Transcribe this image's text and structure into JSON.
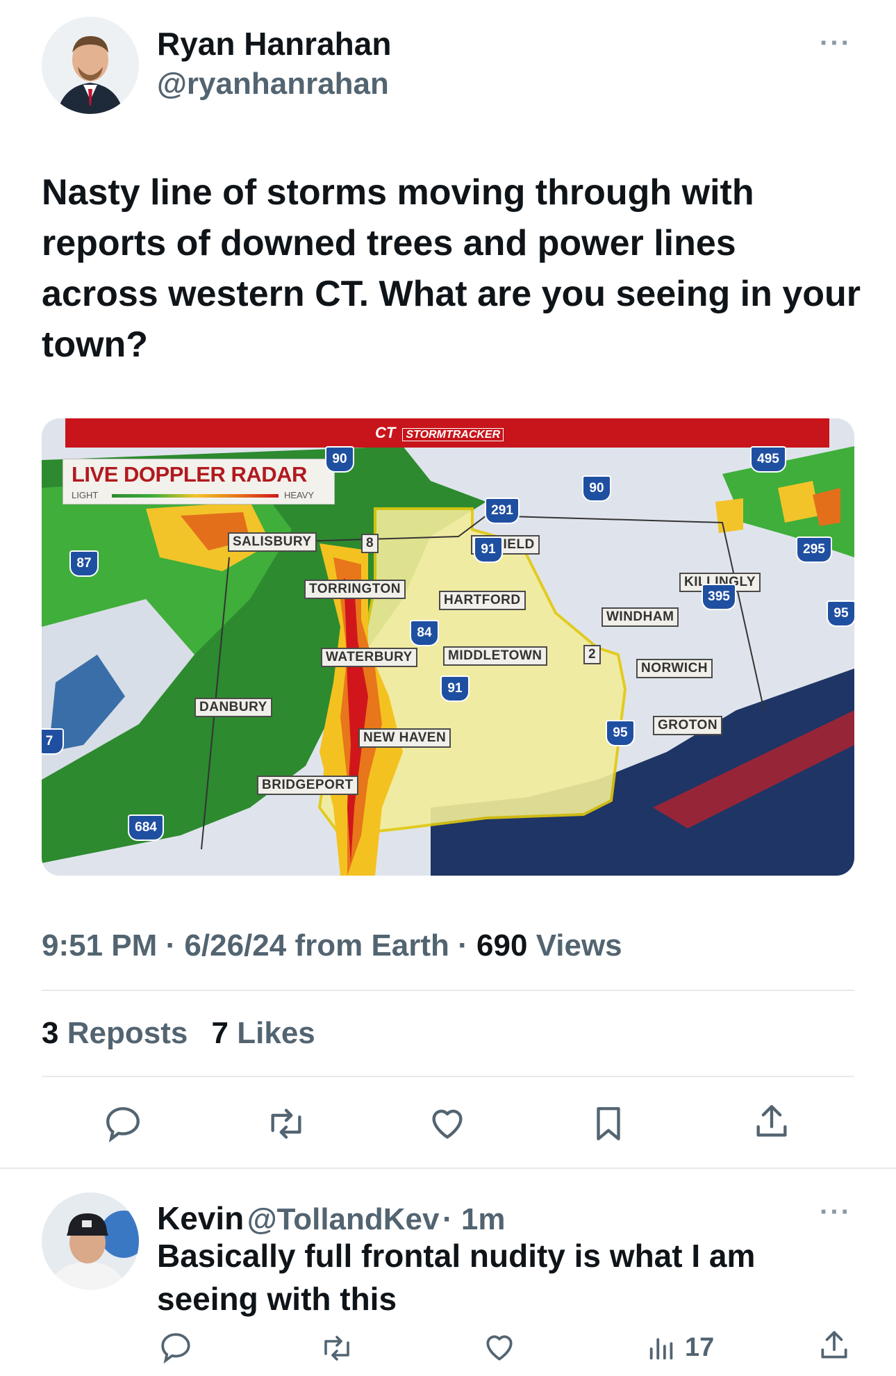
{
  "tweet": {
    "author_name": "Ryan Hanrahan",
    "author_handle": "@ryanhanrahan",
    "more": "···",
    "text": "Nasty line of storms moving through with reports of downed trees and power lines across western CT. What are you seeing in your town?",
    "time": "9:51 PM",
    "date_source": "6/26/24 from Earth",
    "views_count": "690",
    "views_label": "Views",
    "reposts_count": "3",
    "reposts_label": "Reposts",
    "likes_count": "7",
    "likes_label": "Likes"
  },
  "radar": {
    "brand": "CT",
    "brand_sub": "STORMTRACKER",
    "title": "LIVE DOPPLER RADAR",
    "scale_light": "LIGHT",
    "scale_heavy": "HEAVY",
    "towns": [
      "SALISBURY",
      "ENFIELD",
      "TORRINGTON",
      "HARTFORD",
      "KILLINGLY",
      "WINDHAM",
      "WATERBURY",
      "MIDDLETOWN",
      "NORWICH",
      "DANBURY",
      "GROTON",
      "NEW HAVEN",
      "BRIDGEPORT"
    ],
    "highways": [
      "90",
      "495",
      "291",
      "90",
      "8",
      "91",
      "87",
      "295",
      "395",
      "95",
      "84",
      "2",
      "91",
      "95",
      "684",
      "7"
    ]
  },
  "reply": {
    "author_name": "Kevin",
    "author_handle": "@TollandKev",
    "time": "· 1m",
    "more": "···",
    "text": "Basically full frontal nudity is what I am seeing with this",
    "views": "17"
  },
  "colors": {
    "accent": "#1d9bf0",
    "muted": "#536471",
    "radar_red": "#c8141b"
  }
}
